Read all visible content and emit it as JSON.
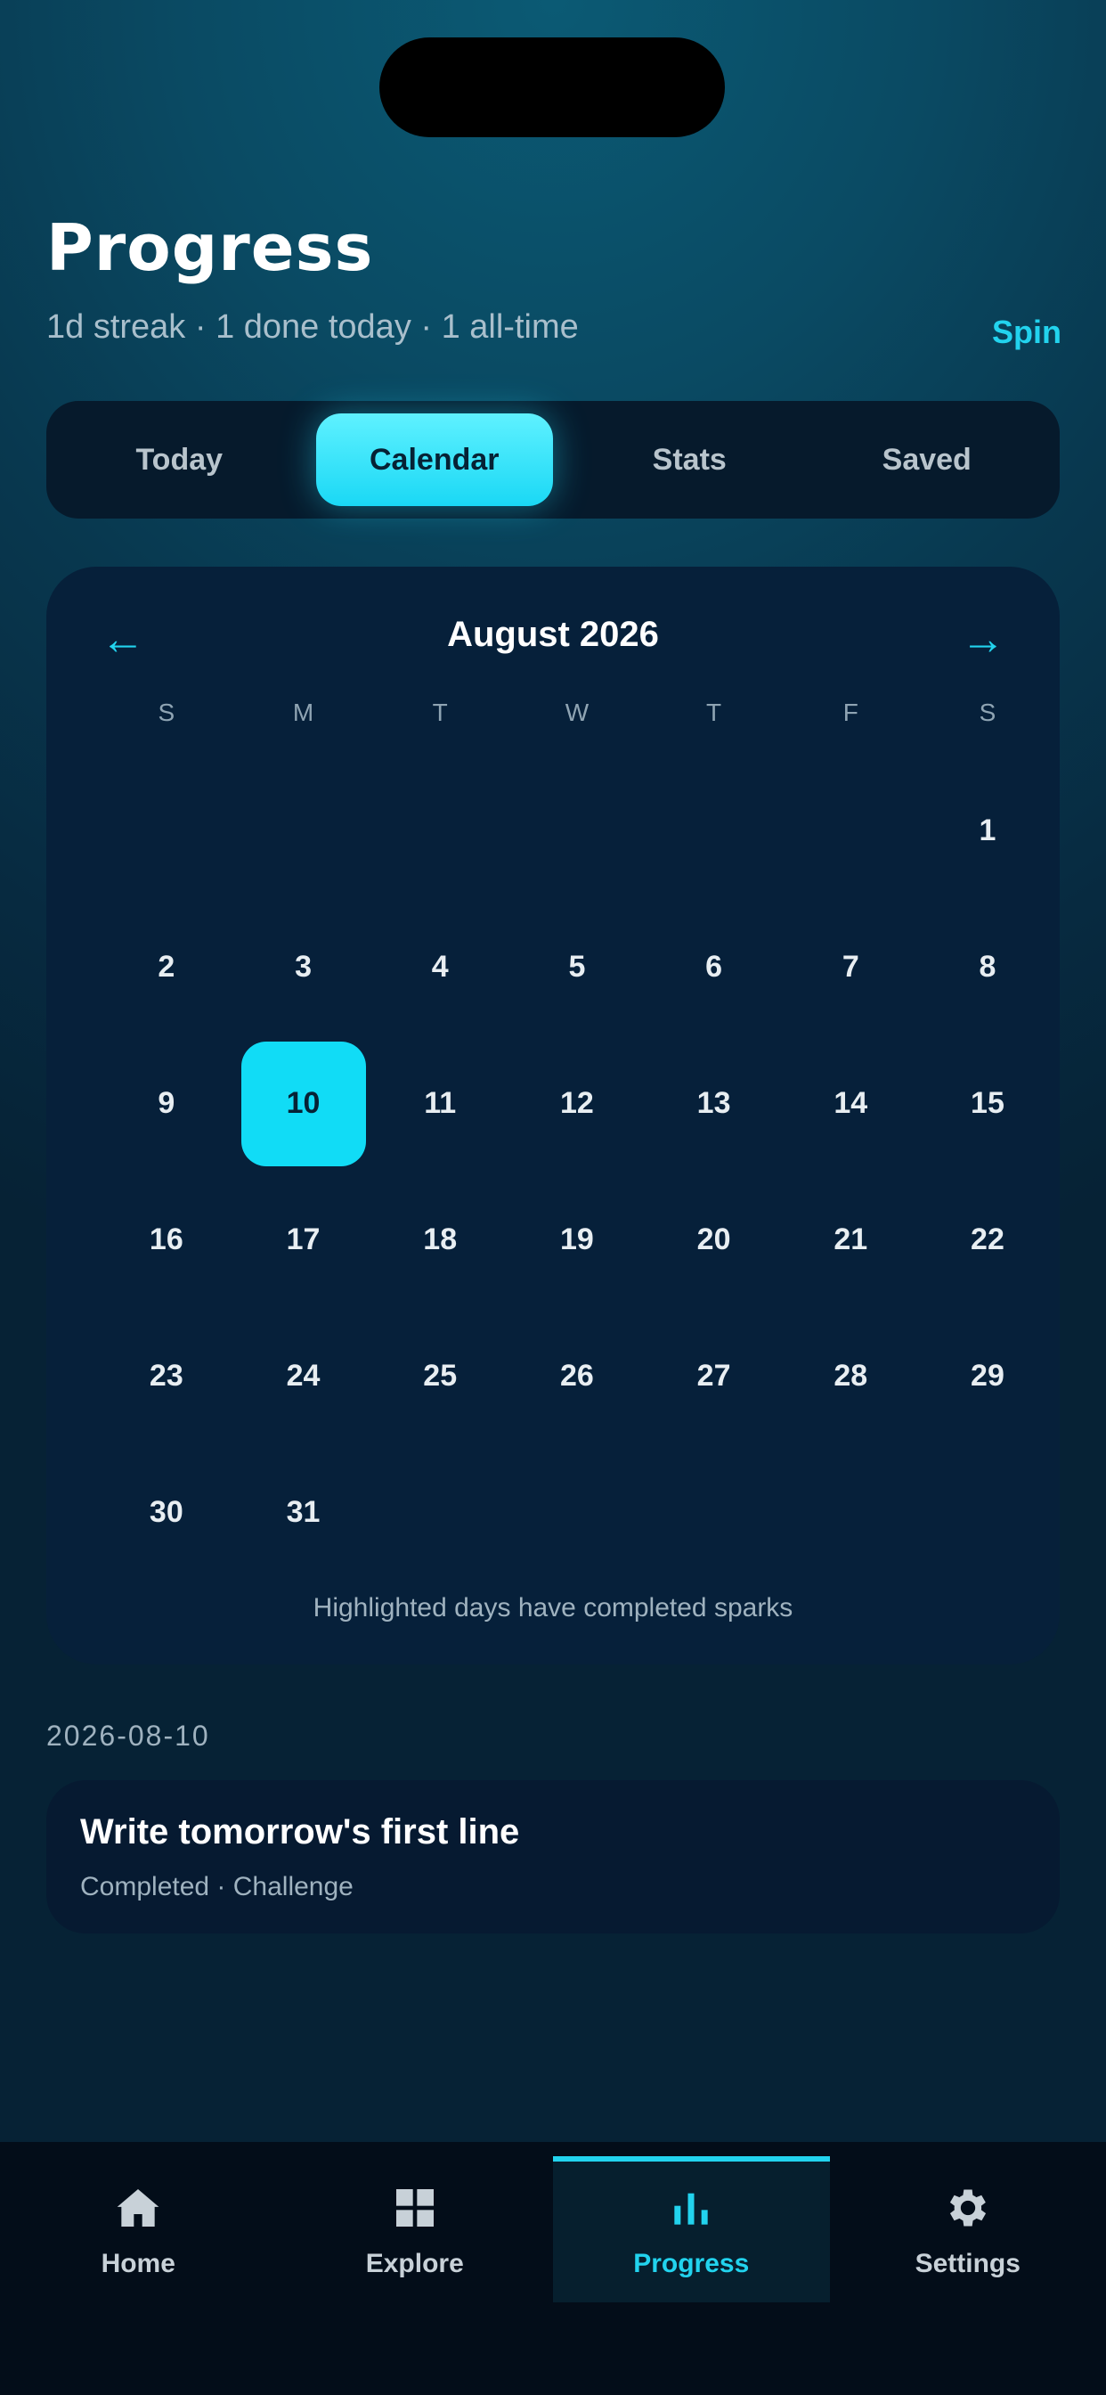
{
  "header": {
    "title": "Progress",
    "subtitle": "1d streak · 1 done today · 1 all-time",
    "spin_label": "Spin"
  },
  "tabs": [
    {
      "label": "Today",
      "active": false
    },
    {
      "label": "Calendar",
      "active": true
    },
    {
      "label": "Stats",
      "active": false
    },
    {
      "label": "Saved",
      "active": false
    }
  ],
  "calendar": {
    "prev_icon": "←",
    "next_icon": "→",
    "month_title": "August 2026",
    "weekdays": [
      "S",
      "M",
      "T",
      "W",
      "T",
      "F",
      "S"
    ],
    "leading_blank_days": 6,
    "days_in_month": 31,
    "highlighted_days": [
      10
    ],
    "footnote": "Highlighted days have completed sparks"
  },
  "selected_date": "2026-08-10",
  "entry": {
    "title": "Write tomorrow's first line",
    "meta": "Completed · Challenge"
  },
  "bottom_nav": [
    {
      "label": "Home",
      "icon": "home-icon",
      "active": false
    },
    {
      "label": "Explore",
      "icon": "grid-icon",
      "active": false
    },
    {
      "label": "Progress",
      "icon": "bar-chart-icon",
      "active": true
    },
    {
      "label": "Settings",
      "icon": "gear-icon",
      "active": false
    }
  ],
  "colors": {
    "accent": "#22d3ee",
    "highlight": "#11dcf6",
    "card": "#06203a"
  }
}
